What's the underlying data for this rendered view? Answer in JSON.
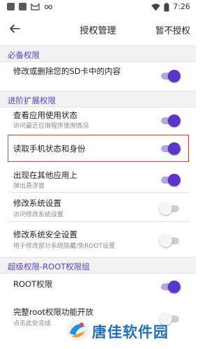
{
  "status_bar": {
    "time": "7:26",
    "left_icons": [
      "notification-icon",
      "notification-icon",
      "cat-face-icon",
      "infinity-icon"
    ],
    "right_icons": [
      "wifi-icon",
      "battery-icon"
    ]
  },
  "toolbar": {
    "title": "授权管理",
    "action_label": "暂不授权",
    "back_icon": "back-arrow-icon"
  },
  "sections": [
    {
      "label": "必备权限",
      "items": [
        {
          "title": "修改或删除您的SD卡中的内容",
          "subtitle": "修改或删除您的SD卡中的内容",
          "enabled": true
        }
      ]
    },
    {
      "label": "进阶扩展权限",
      "items": [
        {
          "title": "查看应用使用状态",
          "subtitle": "访问最近应用程序使用情况",
          "enabled": true
        },
        {
          "title": "读取手机状态和身份",
          "subtitle": "",
          "enabled": true,
          "highlighted": true
        },
        {
          "title": "出现在其他应用上",
          "subtitle": "弹出悬浮窗",
          "enabled": true
        },
        {
          "title": "修改系统设置",
          "subtitle": "访问修改系统设置",
          "enabled": false
        },
        {
          "title": "修改系统安全设置",
          "subtitle": "用于修改部分系统隐藏/免ROOT设置",
          "enabled": false
        }
      ]
    },
    {
      "label": "超级权限-ROOT权限组",
      "items": [
        {
          "title": "ROOT权限",
          "subtitle": "",
          "enabled": true
        },
        {
          "title": "完整root权限功能开放",
          "subtitle": "点击此处完成",
          "enabled": false
        }
      ]
    }
  ],
  "watermark": {
    "text": "唐佳软件园"
  },
  "colors": {
    "accent": "#5b34c9",
    "section_text": "#5b3fc4",
    "highlight_border": "#e0403a",
    "watermark": "#1f6fb8"
  }
}
